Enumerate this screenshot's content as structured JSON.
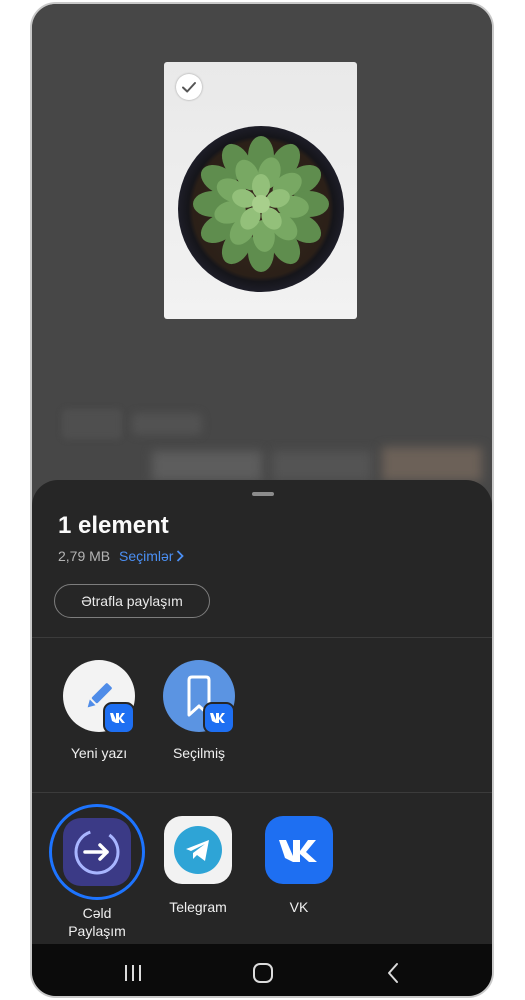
{
  "share_sheet": {
    "title": "1 element",
    "file_size": "2,79 MB",
    "selections_link": "Seçimlər",
    "share_more_button": "Ətrafla paylaşım"
  },
  "contacts_row": [
    {
      "label": "Yeni yazı",
      "icon": "pencil-icon",
      "badge": "vk-badge-icon"
    },
    {
      "label": "Seçilmiş",
      "icon": "bookmark-icon",
      "badge": "vk-badge-icon"
    }
  ],
  "apps_row": [
    {
      "label": "Cəld Paylaşım",
      "label_line1": "Cəld",
      "label_line2": "Paylaşım",
      "icon": "quick-share-icon",
      "highlighted": true
    },
    {
      "label": "Telegram",
      "icon": "telegram-icon"
    },
    {
      "label": "VK",
      "icon": "vk-icon"
    }
  ],
  "colors": {
    "accent": "#4b8ff3",
    "sheet_bg": "#262626",
    "vk_blue": "#1e6ff2",
    "highlight_ring": "#1d74ff"
  },
  "nav": [
    "recent-apps-icon",
    "home-icon",
    "back-icon"
  ]
}
